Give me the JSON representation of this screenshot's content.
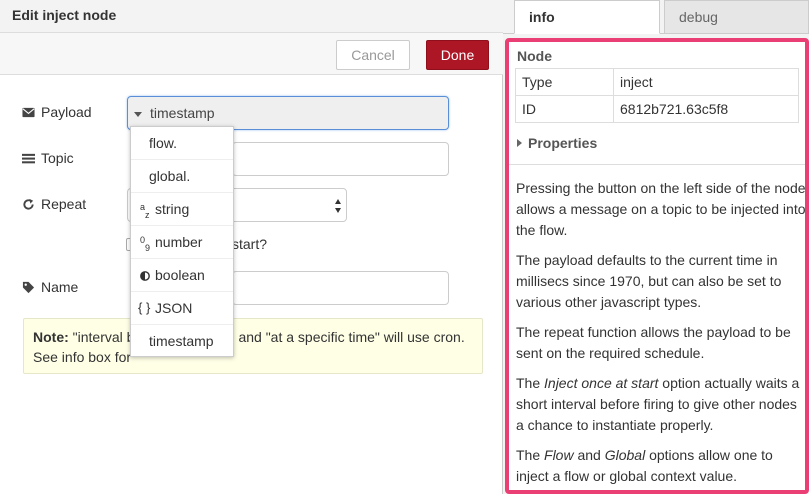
{
  "editor": {
    "title": "Edit inject node",
    "cancel_label": "Cancel",
    "done_label": "Done",
    "fields": {
      "payload_label": "Payload",
      "payload_value": "timestamp",
      "topic_label": "Topic",
      "repeat_label": "Repeat",
      "inject_once_label": "start?",
      "name_label": "Name"
    },
    "note": {
      "bold": "Note:",
      "text_a": " \"interval b",
      "text_b": "and \"at a specific time\" will use cron.",
      "text_c": "See info box for"
    }
  },
  "dropdown": {
    "items": [
      {
        "label": "flow.",
        "icon": ""
      },
      {
        "label": "global.",
        "icon": ""
      },
      {
        "label": "string",
        "icon": "az-icon"
      },
      {
        "label": "number",
        "icon": "09-icon"
      },
      {
        "label": "boolean",
        "icon": "toggle-icon"
      },
      {
        "label": "JSON",
        "icon": "braces-icon"
      },
      {
        "label": "timestamp",
        "icon": ""
      }
    ]
  },
  "sidebar": {
    "tabs": [
      "info",
      "debug"
    ],
    "section_title": "Node",
    "table": [
      {
        "key": "Type",
        "value": "inject"
      },
      {
        "key": "ID",
        "value": "6812b721.63c5f8"
      }
    ],
    "properties_label": "Properties",
    "help": [
      "Pressing the button on the left side of the node allows a message on a topic to be injected into the flow.",
      "The payload defaults to the current time in millisecs since 1970, but can also be set to various other javascript types.",
      "The repeat function allows the payload to be sent on the required schedule.",
      "The Inject once at start option actually waits a short interval before firing to give other nodes a chance to instantiate properly.",
      "The Flow and Global options allow one to inject a flow or global context value."
    ],
    "help_em": {
      "p4_pre": "The ",
      "p4_em": "Inject once at start",
      "p4_post": " option actually waits a short interval before firing to give other nodes a chance to instantiate properly.",
      "p5_pre": "The ",
      "p5_em1": "Flow",
      "p5_mid": " and ",
      "p5_em2": "Global",
      "p5_post": " options allow one to inject a flow or global context value."
    }
  },
  "colors": {
    "done": "#ad1625",
    "highlight_border": "#ea3f74",
    "note_bg": "#ffffe6"
  }
}
